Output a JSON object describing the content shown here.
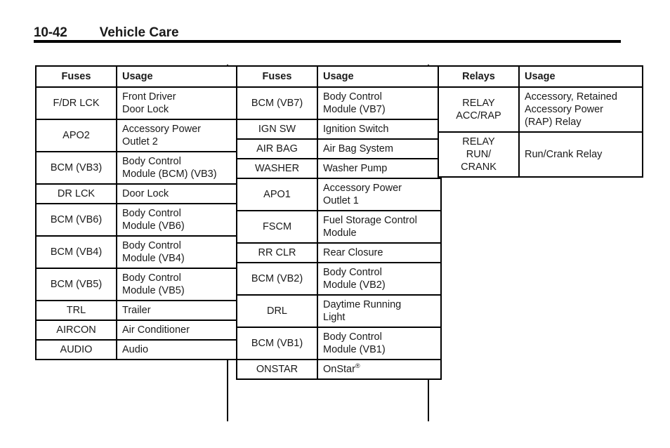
{
  "header": {
    "page_number": "10-42",
    "title": "Vehicle Care"
  },
  "tables": [
    {
      "id": "fuse-table-left",
      "headers": {
        "key": "Fuses",
        "usage": "Usage"
      },
      "rows": [
        {
          "key": "F/DR LCK",
          "usage": "Front Driver\nDoor Lock"
        },
        {
          "key": "APO2",
          "usage": "Accessory Power\nOutlet 2"
        },
        {
          "key": "BCM (VB3)",
          "usage": "Body Control\nModule (BCM) (VB3)"
        },
        {
          "key": "DR LCK",
          "usage": "Door Lock"
        },
        {
          "key": "BCM (VB6)",
          "usage": "Body Control\nModule (VB6)"
        },
        {
          "key": "BCM (VB4)",
          "usage": "Body Control\nModule (VB4)"
        },
        {
          "key": "BCM (VB5)",
          "usage": "Body Control\nModule (VB5)"
        },
        {
          "key": "TRL",
          "usage": "Trailer"
        },
        {
          "key": "AIRCON",
          "usage": "Air Conditioner"
        },
        {
          "key": "AUDIO",
          "usage": "Audio"
        }
      ]
    },
    {
      "id": "fuse-table-middle",
      "headers": {
        "key": "Fuses",
        "usage": "Usage"
      },
      "rows": [
        {
          "key": "BCM (VB7)",
          "usage": "Body Control\nModule (VB7)"
        },
        {
          "key": "IGN SW",
          "usage": "Ignition Switch"
        },
        {
          "key": "AIR BAG",
          "usage": "Air Bag System"
        },
        {
          "key": "WASHER",
          "usage": "Washer Pump"
        },
        {
          "key": "APO1",
          "usage": "Accessory Power\nOutlet 1"
        },
        {
          "key": "FSCM",
          "usage": "Fuel Storage Control\nModule"
        },
        {
          "key": "RR CLR",
          "usage": "Rear Closure"
        },
        {
          "key": "BCM (VB2)",
          "usage": "Body Control\nModule (VB2)"
        },
        {
          "key": "DRL",
          "usage": "Daytime Running\nLight"
        },
        {
          "key": "BCM (VB1)",
          "usage": "Body Control\nModule (VB1)"
        },
        {
          "key": "ONSTAR",
          "usage": "OnStar",
          "usage_sup": "®"
        }
      ]
    },
    {
      "id": "relay-table-right",
      "headers": {
        "key": "Relays",
        "usage": "Usage"
      },
      "rows": [
        {
          "key": "RELAY\nACC/RAP",
          "usage": "Accessory, Retained\nAccessory Power\n(RAP) Relay"
        },
        {
          "key": "RELAY\nRUN/\nCRANK",
          "usage": "Run/Crank Relay"
        }
      ]
    }
  ]
}
